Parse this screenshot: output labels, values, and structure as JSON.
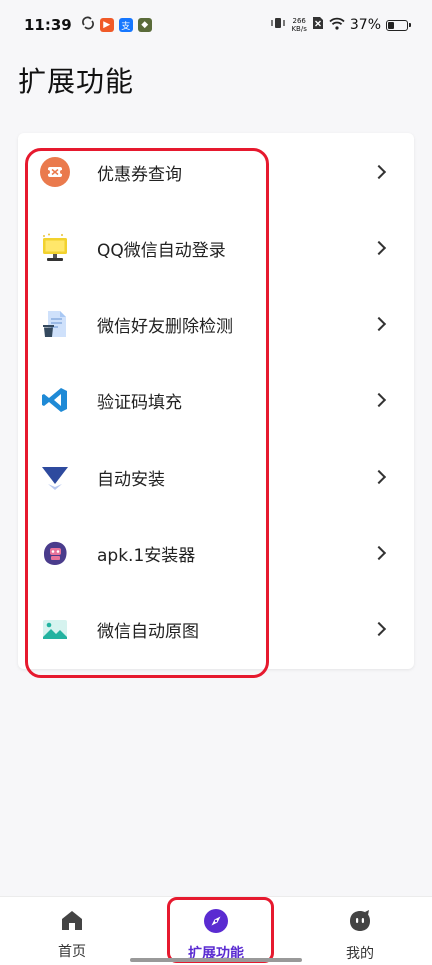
{
  "status_bar": {
    "time": "11:39",
    "net_speed_value": "266",
    "net_speed_unit": "KB/s",
    "battery": "37%",
    "battery_level": 0.37
  },
  "page": {
    "title": "扩展功能"
  },
  "items": [
    {
      "label": "优惠券查询",
      "icon": "coupon-icon"
    },
    {
      "label": "QQ微信自动登录",
      "icon": "monitor-login-icon"
    },
    {
      "label": "微信好友删除检测",
      "icon": "document-trash-icon"
    },
    {
      "label": "验证码填充",
      "icon": "vscode-icon"
    },
    {
      "label": "自动安装",
      "icon": "triangle-install-icon"
    },
    {
      "label": "apk.1安装器",
      "icon": "robot-icon"
    },
    {
      "label": "微信自动原图",
      "icon": "image-icon"
    }
  ],
  "bottom_nav": [
    {
      "label": "首页",
      "icon": "home-icon",
      "active": false
    },
    {
      "label": "扩展功能",
      "icon": "compass-icon",
      "active": true
    },
    {
      "label": "我的",
      "icon": "profile-face-icon",
      "active": false
    }
  ],
  "colors": {
    "accent": "#5a2bd1",
    "highlight": "#e6192e",
    "background": "#f7f7f9"
  }
}
